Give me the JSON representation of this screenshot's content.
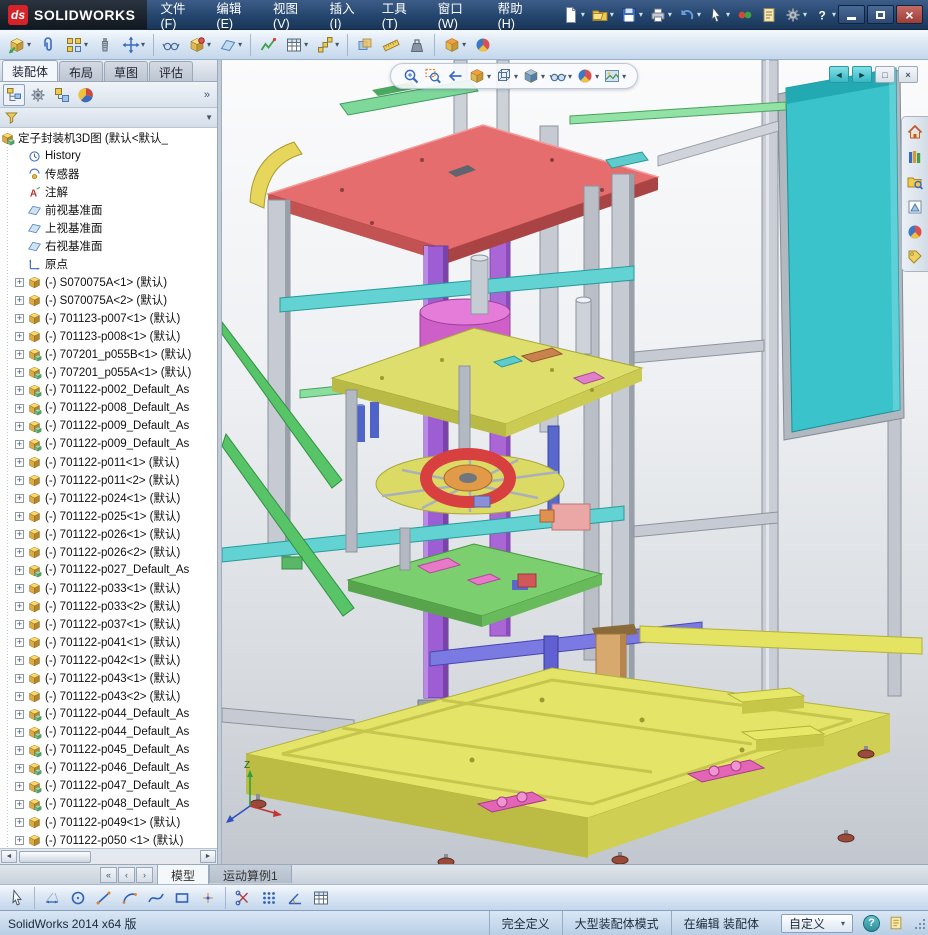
{
  "colors": {
    "brand_red": "#d6232a",
    "titlebar_blue": "#24466e",
    "panel_teal": "#3ac3cb",
    "plate_red": "#e56d6d",
    "base_yellow": "#e4e468",
    "column_purple": "#9c5ed2",
    "accent_blue": "#3a6ac0"
  },
  "ui": {
    "dropdown_glyph": "▾",
    "expander_glyph": "+"
  },
  "title_bar": {
    "logo_ds": "ds",
    "logo_text": "SOLIDWORKS",
    "menus": [
      "文件(F)",
      "编辑(E)",
      "视图(V)",
      "插入(I)",
      "工具(T)",
      "窗口(W)",
      "帮助(H)"
    ],
    "quick_icons": [
      {
        "name": "new-document",
        "dropdown": true
      },
      {
        "name": "open-document",
        "dropdown": true
      },
      {
        "name": "save-document",
        "dropdown": true
      },
      {
        "name": "print-document",
        "dropdown": true
      },
      {
        "name": "undo",
        "dropdown": true
      },
      {
        "name": "select",
        "dropdown": true
      },
      {
        "name": "rebuild",
        "dropdown": false
      },
      {
        "name": "file-properties",
        "dropdown": false
      },
      {
        "name": "options",
        "dropdown": true
      },
      {
        "name": "help",
        "dropdown": true
      }
    ],
    "close_glyph": "×"
  },
  "toolbar": {
    "buttons": [
      {
        "name": "insert-components",
        "dropdown": true
      },
      {
        "name": "mate",
        "dropdown": false
      },
      {
        "name": "linear-component-pattern",
        "dropdown": true
      },
      {
        "name": "smart-fasteners",
        "dropdown": false
      },
      {
        "name": "move-component",
        "dropdown": true
      },
      {
        "sep": true
      },
      {
        "name": "show-hidden-components",
        "dropdown": false
      },
      {
        "name": "assembly-features",
        "dropdown": true
      },
      {
        "name": "reference-geometry",
        "dropdown": true
      },
      {
        "sep": true
      },
      {
        "name": "new-motion-study",
        "dropdown": false
      },
      {
        "name": "bill-of-materials",
        "dropdown": true
      },
      {
        "name": "exploded-view",
        "dropdown": true
      },
      {
        "sep": true
      },
      {
        "name": "interference-detection",
        "dropdown": false
      },
      {
        "name": "measure",
        "dropdown": false
      },
      {
        "name": "mass-properties",
        "dropdown": false
      },
      {
        "sep": true
      },
      {
        "name": "section-view",
        "dropdown": true
      },
      {
        "name": "edit-appearance",
        "dropdown": false
      }
    ]
  },
  "feature_panel": {
    "tabs": [
      {
        "label": "装配体",
        "active": true
      },
      {
        "label": "布局",
        "active": false
      },
      {
        "label": "草图",
        "active": false
      },
      {
        "label": "评估",
        "active": false
      }
    ],
    "panel_icons": [
      "featuremanager-tree",
      "propertymanager",
      "configurationmanager",
      "displaymanager"
    ],
    "overflow_label": "»",
    "filter_arrow": "▼",
    "scroll_left": "◄",
    "scroll_right": "►",
    "root": {
      "icon": "assembly",
      "label": "定子封装机3D图 (默认<默认_"
    },
    "items": [
      {
        "icon": "history",
        "label": "History"
      },
      {
        "icon": "sensors",
        "label": "传感器"
      },
      {
        "icon": "annotations",
        "label": "注解"
      },
      {
        "icon": "plane",
        "label": "前视基准面"
      },
      {
        "icon": "plane",
        "label": "上视基准面"
      },
      {
        "icon": "plane",
        "label": "右视基准面"
      },
      {
        "icon": "origin",
        "label": "原点"
      },
      {
        "icon": "part",
        "expand": true,
        "label": "(-) S070075A<1> (默认)"
      },
      {
        "icon": "part",
        "expand": true,
        "label": "(-) S070075A<2> (默认)"
      },
      {
        "icon": "part",
        "expand": true,
        "label": "(-) 701123-p007<1> (默认)"
      },
      {
        "icon": "part",
        "expand": true,
        "label": "(-) 701123-p008<1> (默认)"
      },
      {
        "icon": "assembly",
        "expand": true,
        "label": "(-) 707201_p055B<1> (默认)"
      },
      {
        "icon": "assembly",
        "expand": true,
        "label": "(-) 707201_p055A<1> (默认)"
      },
      {
        "icon": "assembly",
        "expand": true,
        "label": "(-) 701122-p002_Default_As"
      },
      {
        "icon": "assembly",
        "expand": true,
        "label": "(-) 701122-p008_Default_As"
      },
      {
        "icon": "assembly",
        "expand": true,
        "label": "(-) 701122-p009_Default_As"
      },
      {
        "icon": "assembly",
        "expand": true,
        "label": "(-) 701122-p009_Default_As"
      },
      {
        "icon": "part",
        "expand": true,
        "label": "(-) 701122-p011<1> (默认)"
      },
      {
        "icon": "part",
        "expand": true,
        "label": "(-) 701122-p011<2> (默认)"
      },
      {
        "icon": "part",
        "expand": true,
        "label": "(-) 701122-p024<1> (默认)"
      },
      {
        "icon": "part",
        "expand": true,
        "label": "(-) 701122-p025<1> (默认)"
      },
      {
        "icon": "part",
        "expand": true,
        "label": "(-) 701122-p026<1> (默认)"
      },
      {
        "icon": "part",
        "expand": true,
        "label": "(-) 701122-p026<2> (默认)"
      },
      {
        "icon": "assembly",
        "expand": true,
        "label": "(-) 701122-p027_Default_As"
      },
      {
        "icon": "part",
        "expand": true,
        "label": "(-) 701122-p033<1> (默认)"
      },
      {
        "icon": "part",
        "expand": true,
        "label": "(-) 701122-p033<2> (默认)"
      },
      {
        "icon": "part",
        "expand": true,
        "label": "(-) 701122-p037<1> (默认)"
      },
      {
        "icon": "part",
        "expand": true,
        "label": "(-) 701122-p041<1> (默认)"
      },
      {
        "icon": "part",
        "expand": true,
        "label": "(-) 701122-p042<1> (默认)"
      },
      {
        "icon": "part",
        "expand": true,
        "label": "(-) 701122-p043<1> (默认)"
      },
      {
        "icon": "part",
        "expand": true,
        "label": "(-) 701122-p043<2> (默认)"
      },
      {
        "icon": "assembly",
        "expand": true,
        "label": "(-) 701122-p044_Default_As"
      },
      {
        "icon": "assembly",
        "expand": true,
        "label": "(-) 701122-p044_Default_As"
      },
      {
        "icon": "assembly",
        "expand": true,
        "label": "(-) 701122-p045_Default_As"
      },
      {
        "icon": "assembly",
        "expand": true,
        "label": "(-) 701122-p046_Default_As"
      },
      {
        "icon": "assembly",
        "expand": true,
        "label": "(-) 701122-p047_Default_As"
      },
      {
        "icon": "assembly",
        "expand": true,
        "label": "(-) 701122-p048_Default_As"
      },
      {
        "icon": "part",
        "expand": true,
        "label": "(-) 701122-p049<1> (默认)"
      },
      {
        "icon": "part",
        "expand": true,
        "label": "(-) 701122-p050 <1> (默认)"
      }
    ]
  },
  "viewport": {
    "headsup": [
      {
        "name": "zoom-to-fit",
        "dropdown": false
      },
      {
        "name": "zoom-to-area",
        "dropdown": false
      },
      {
        "name": "previous-view",
        "dropdown": false
      },
      {
        "name": "section-view",
        "dropdown": true
      },
      {
        "name": "view-orientation",
        "dropdown": true
      },
      {
        "name": "display-style",
        "dropdown": true
      },
      {
        "name": "hide-show-items",
        "dropdown": true
      },
      {
        "name": "edit-appearance",
        "dropdown": true
      },
      {
        "name": "apply-scene",
        "dropdown": true
      }
    ],
    "doc_controls": [
      {
        "name": "previous-document",
        "glyph": "◄"
      },
      {
        "name": "next-document",
        "glyph": "►"
      },
      {
        "name": "restore-document",
        "glyph": "□"
      },
      {
        "name": "close-document",
        "glyph": "×"
      }
    ],
    "task_pane": [
      "resources-home",
      "design-library",
      "file-explorer",
      "view-palette",
      "appearances",
      "custom-properties"
    ],
    "triad_label": "Z"
  },
  "doc_tabs": {
    "nav": [
      "«",
      "‹",
      "›"
    ],
    "tabs": [
      {
        "label": "模型",
        "active": true
      },
      {
        "label": "运动算例1",
        "active": false
      }
    ]
  },
  "sketch_toolbar": {
    "buttons": [
      {
        "name": "select"
      },
      {
        "sep": true
      },
      {
        "name": "smart-dimension"
      },
      {
        "name": "circle"
      },
      {
        "name": "line"
      },
      {
        "name": "arc"
      },
      {
        "name": "spline"
      },
      {
        "name": "rectangle"
      },
      {
        "name": "point"
      },
      {
        "sep": true
      },
      {
        "name": "trim-entities"
      },
      {
        "name": "linear-sketch-pattern"
      },
      {
        "name": "angle-dimension"
      },
      {
        "name": "sketch-table"
      }
    ]
  },
  "status_bar": {
    "left": "SolidWorks 2014 x64 版",
    "segments": [
      "完全定义",
      "大型装配体模式",
      "在编辑 装配体"
    ],
    "custom_combo": "自定义",
    "help_glyph": "?"
  }
}
